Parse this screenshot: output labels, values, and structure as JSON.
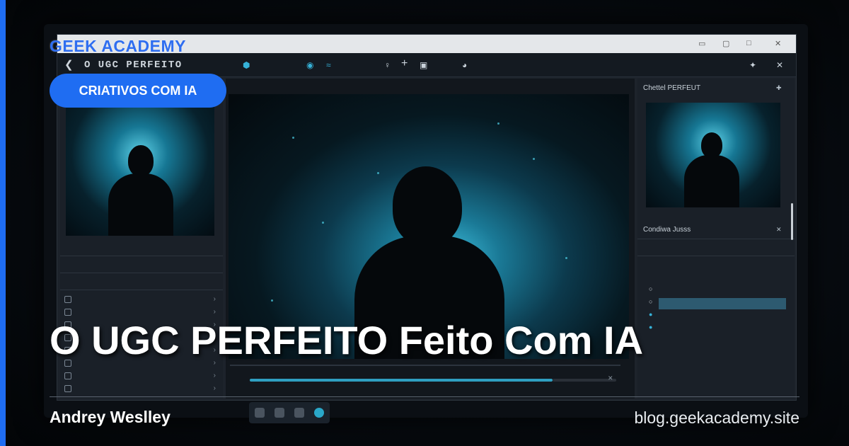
{
  "brand": {
    "name": "GEEK ACADEMY",
    "tag": "CRIATIVOS COM IA"
  },
  "headline": "O UGC PERFEITO Feito Com IA",
  "author": "Andrey Weslley",
  "site": "blog.geekacademy.site",
  "colors": {
    "accent": "#1f6df2",
    "cyan": "#36b2d8"
  },
  "app": {
    "toolbar_title": "O UGC PERFEITO",
    "right_panel_title": "Chettel PERFEUT",
    "right_section": "Condiwa Jusss"
  }
}
